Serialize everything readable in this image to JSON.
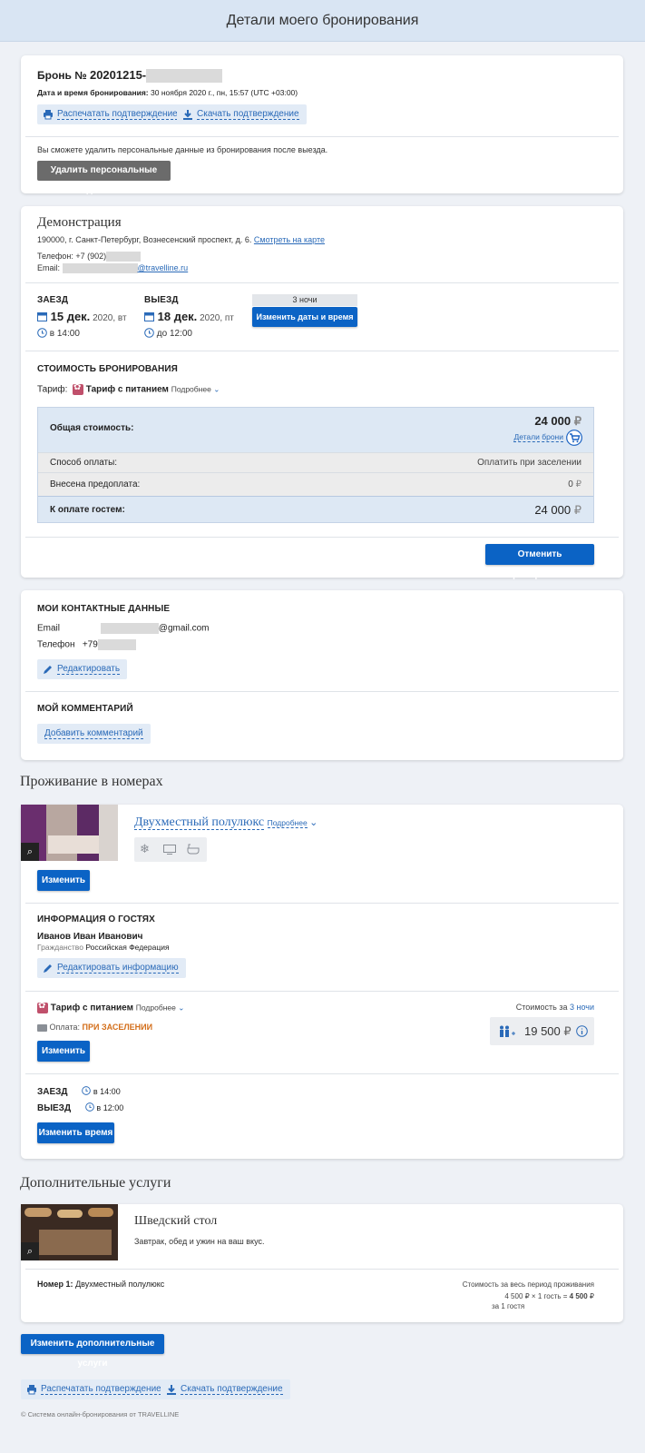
{
  "header": {
    "title": "Детали моего бронирования"
  },
  "booking": {
    "number_label": "Бронь  №",
    "number_prefix": "20201215-",
    "date_label": "Дата и время бронирования:",
    "date_value": "30 ноября 2020 г., пн, 15:57 (UTC +03:00)",
    "print_label": "Распечатать подтверждение",
    "download_label": "Скачать подтверждение",
    "delete_note": "Вы сможете удалить персональные данные из бронирования после выезда.",
    "delete_button": "Удалить персональные данные"
  },
  "hotel": {
    "name": "Демонстрация",
    "address": "190000, г. Санкт-Петербург, Вознесенский проспект, д. 6.",
    "map_link": "Смотреть на карте",
    "phone_label": "Телефон:",
    "phone_value": "+7 (902)",
    "email_label": "Email:",
    "email_domain": "@travelline.ru"
  },
  "stay": {
    "checkin_label": "ЗАЕЗД",
    "checkin_day": "15 дек.",
    "checkin_rest": "2020, вт",
    "checkin_time": "в 14:00",
    "checkout_label": "ВЫЕЗД",
    "checkout_day": "18 дек.",
    "checkout_rest": "2020, пт",
    "checkout_time": "до 12:00",
    "nights": "3 ночи",
    "change_dates": "Изменить даты и время"
  },
  "cost": {
    "section_title": "СТОИМОСТЬ БРОНИРОВАНИЯ",
    "tariff_label": "Тариф:",
    "tariff_name": "Тариф с питанием",
    "tariff_more": "Подробнее",
    "total_label": "Общая стоимость:",
    "total_value": "24 000",
    "currency": "₽",
    "details_link": "Детали брони",
    "payment_label": "Способ оплаты:",
    "payment_value": "Оплатить при заселении",
    "prepaid_label": "Внесена предоплата:",
    "prepaid_value": "0",
    "due_label": "К оплате гостем:",
    "due_value": "24 000",
    "cancel_button": "Отменить бронирование"
  },
  "contacts": {
    "section_title": "МОИ КОНТАКТНЫЕ ДАННЫЕ",
    "email_label": "Email",
    "email_domain": "@gmail.com",
    "phone_label": "Телефон",
    "phone_prefix": "+79",
    "edit_label": "Редактировать",
    "comment_title": "МОЙ КОММЕНТАРИЙ",
    "add_comment": "Добавить комментарий"
  },
  "rooms": {
    "section_title": "Проживание в номерах",
    "room_name": "Двухместный полулюкс",
    "room_more": "Подробнее",
    "change_button": "Изменить",
    "guests_title": "ИНФОРМАЦИЯ О ГОСТЯХ",
    "guest_name": "Иванов Иван Иванович",
    "citizenship_label": "Гражданство",
    "citizenship_value": "Российская Федерация",
    "edit_info": "Редактировать информацию",
    "tariff_name": "Тариф с питанием",
    "tariff_more": "Подробнее",
    "pay_label": "Оплата:",
    "pay_value": "ПРИ ЗАСЕЛЕНИИ",
    "change_tariff": "Изменить",
    "cost_label": "Стоимость за",
    "cost_nights": "3 ночи",
    "room_price": "19 500",
    "checkin_label": "ЗАЕЗД",
    "checkin_time": "в 14:00",
    "checkout_label": "ВЫЕЗД",
    "checkout_time": "в 12:00",
    "change_time": "Изменить время"
  },
  "extras": {
    "section_title": "Дополнительные услуги",
    "service_name": "Шведский стол",
    "service_desc": "Завтрак, обед и ужин на ваш вкус.",
    "room_label": "Номер 1:",
    "room_value": "Двухместный полулюкс",
    "period_label": "Стоимость за весь период проживания",
    "calc": "4 500 ₽ × 1 гость = ",
    "calc_total": "4 500",
    "per_guest": "за 1 гостя",
    "change_button": "Изменить дополнительные услуги"
  },
  "footer": {
    "print_label": "Распечатать подтверждение",
    "download_label": "Скачать подтверждение",
    "copyright": "© Система онлайн-бронирования от TRAVELLINE"
  }
}
